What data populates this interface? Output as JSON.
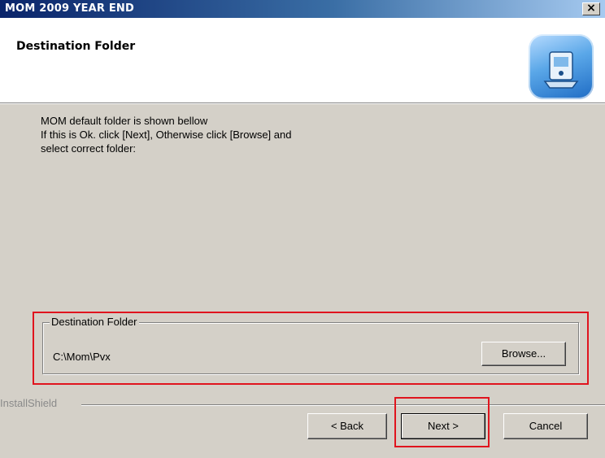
{
  "window": {
    "title": "MOM 2009 YEAR END",
    "close_label": "×"
  },
  "header": {
    "title": "Destination Folder",
    "icon": "computer-setup-icon"
  },
  "body": {
    "line1": "MOM default folder is shown bellow",
    "line2": "If this is Ok. click [Next], Otherwise click [Browse] and",
    "line3": "select correct folder:"
  },
  "destination": {
    "group_label": "Destination Folder",
    "path": "C:\\Mom\\Pvx",
    "browse_label": "Browse..."
  },
  "footer": {
    "brand": "InstallShield",
    "back_label": "< Back",
    "next_label": "Next >",
    "cancel_label": "Cancel"
  },
  "colors": {
    "dialog_background": "#d4d0c8",
    "titlebar_start": "#0a246a",
    "highlight": "#e0141e"
  }
}
